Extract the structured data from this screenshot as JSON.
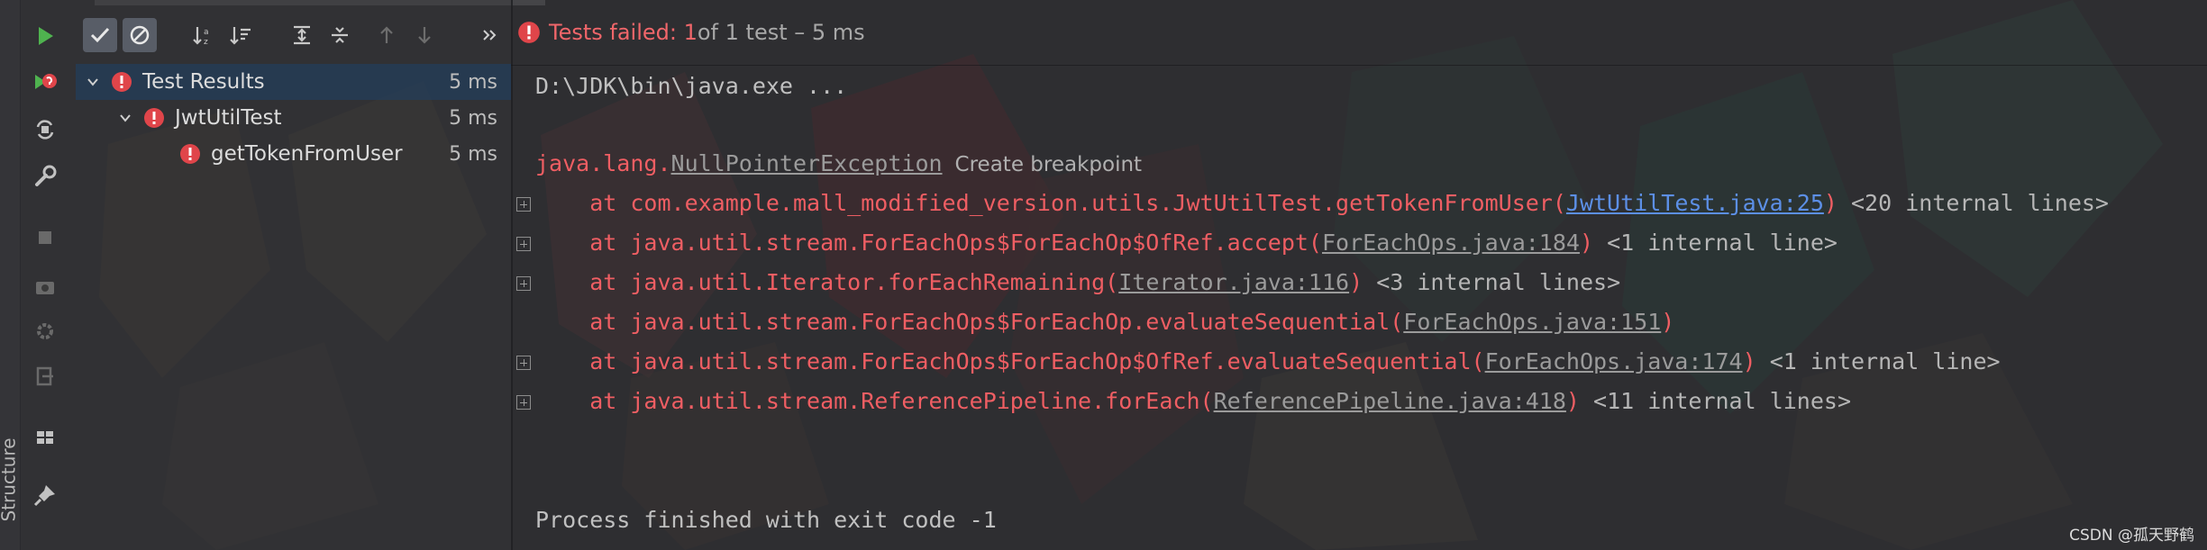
{
  "toolbar": {
    "run_tooltip": "Rerun",
    "buttons": [
      "show-passed",
      "show-ignored",
      "sort-alphabetically",
      "sort-by-duration",
      "expand-all",
      "collapse-all",
      "previous-failed",
      "next-failed",
      "more"
    ]
  },
  "left_strip": {
    "structure_label": "Structure"
  },
  "status": {
    "failed_label": "Tests failed: 1",
    "rest": " of 1 test – 5 ms"
  },
  "tree": {
    "rows": [
      {
        "label": "Test Results",
        "time": "5 ms"
      },
      {
        "label": "JwtUtilTest",
        "time": "5 ms"
      },
      {
        "label": "getTokenFromUser",
        "time": "5 ms"
      }
    ]
  },
  "console": {
    "command": "D:\\JDK\\bin\\java.exe ...",
    "exception_prefix": "java.lang.",
    "exception_name": "NullPointerException",
    "create_breakpoint": "Create breakpoint",
    "frames": [
      {
        "text": "    at com.example.mall_modified_version.utils.JwtUtilTest.getTokenFromUser(",
        "link": "JwtUtilTest.java:25",
        "close": ")",
        "hint": " <20 internal lines>",
        "link_style": "blue",
        "foldable": true
      },
      {
        "text": "    at java.util.stream.ForEachOps$ForEachOp$OfRef.accept(",
        "link": "ForEachOps.java:184",
        "close": ")",
        "hint": " <1 internal line>",
        "link_style": "gray",
        "foldable": true
      },
      {
        "text": "    at java.util.Iterator.forEachRemaining(",
        "link": "Iterator.java:116",
        "close": ")",
        "hint": " <3 internal lines>",
        "link_style": "gray",
        "foldable": true
      },
      {
        "text": "    at java.util.stream.ForEachOps$ForEachOp.evaluateSequential(",
        "link": "ForEachOps.java:151",
        "close": ")",
        "hint": "",
        "link_style": "gray",
        "foldable": false
      },
      {
        "text": "    at java.util.stream.ForEachOps$ForEachOp$OfRef.evaluateSequential(",
        "link": "ForEachOps.java:174",
        "close": ")",
        "hint": " <1 internal line>",
        "link_style": "gray",
        "foldable": true
      },
      {
        "text": "    at java.util.stream.ReferencePipeline.forEach(",
        "link": "ReferencePipeline.java:418",
        "close": ")",
        "hint": " <11 internal lines>",
        "link_style": "gray",
        "foldable": true
      }
    ],
    "finish": "Process finished with exit code -1"
  },
  "watermark": "CSDN @孤天野鹤",
  "colors": {
    "error_red": "#ef5e63",
    "link_blue": "#5c8fe6",
    "selection": "#233e5c",
    "run_green": "#4fb34f"
  }
}
